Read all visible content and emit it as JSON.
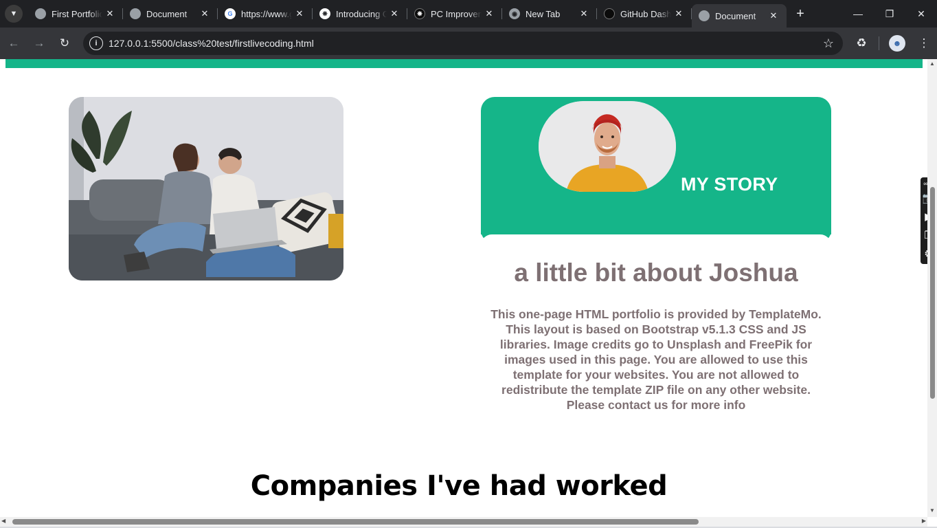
{
  "browser": {
    "tabs": [
      {
        "title": "First Portfolio",
        "favicon": "globe-icon"
      },
      {
        "title": "Document",
        "favicon": "globe-icon"
      },
      {
        "title": "https://www.google.com",
        "favicon": "google-icon"
      },
      {
        "title": "Introducing GPT",
        "favicon": "openai-icon"
      },
      {
        "title": "PC Improvements",
        "favicon": "openai-icon"
      },
      {
        "title": "New Tab",
        "favicon": "chrome-icon"
      },
      {
        "title": "GitHub Dashboard",
        "favicon": "github-icon"
      },
      {
        "title": "Document",
        "favicon": "globe-icon",
        "active": true
      }
    ],
    "url": "127.0.0.1:5500/class%20test/firstlivecoding.html"
  },
  "page": {
    "accent_color": "#15b589",
    "text_color": "#7e7073",
    "story_title": "MY STORY",
    "about_heading": "a little bit about Joshua",
    "about_text": "This one-page HTML portfolio is provided by TemplateMo. This layout is based on Bootstrap v5.1.3 CSS and JS libraries. Image credits go to Unsplash and FreePik for images used in this page. You are allowed to use this template for your websites. You are not allowed to redistribute the template ZIP file on any other website. Please contact us for more info",
    "companies_heading": "Companies I've had worked"
  },
  "scroll": {
    "vertical_position_fraction": 0.52,
    "horizontal_visible_fraction": 0.76
  }
}
